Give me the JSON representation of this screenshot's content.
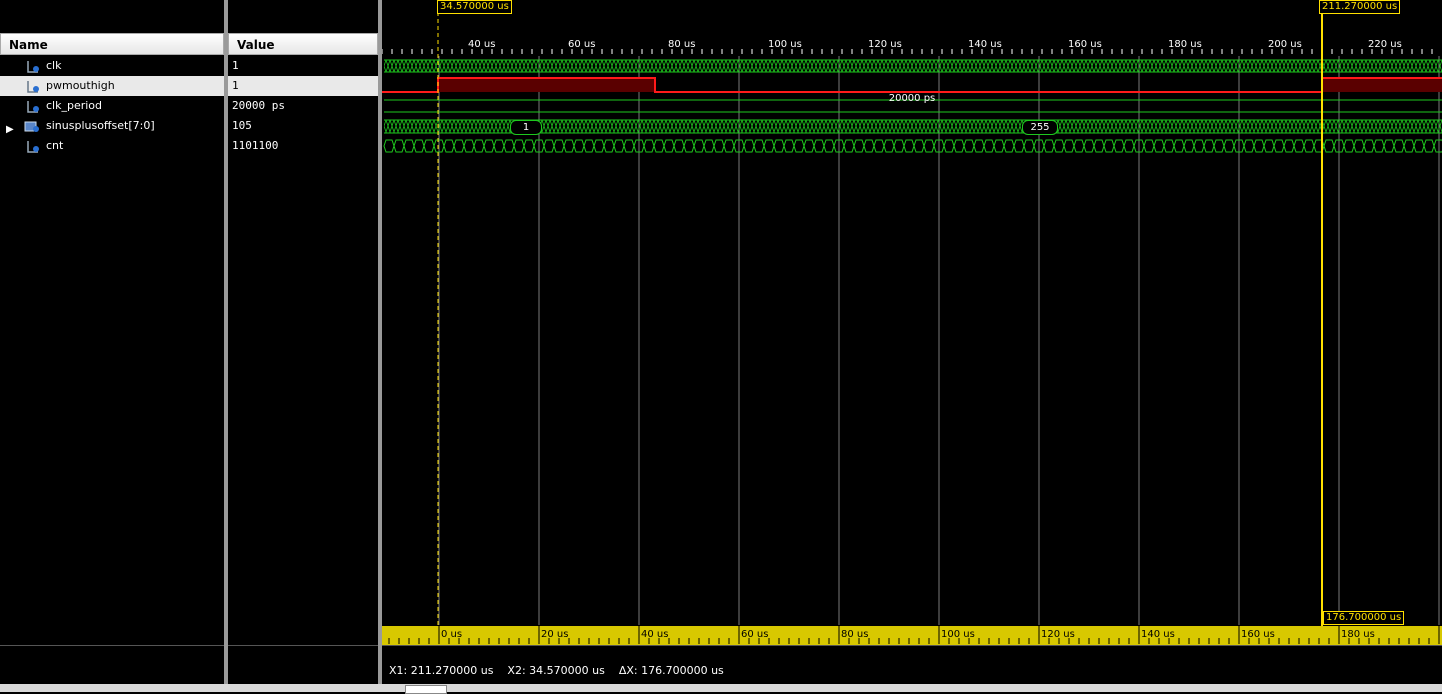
{
  "columns": {
    "name": "Name",
    "value": "Value"
  },
  "signals": [
    {
      "name": "clk",
      "value": "1",
      "icon": "signal-bit-icon"
    },
    {
      "name": "pwmouthigh",
      "value": "1",
      "icon": "signal-bit-icon"
    },
    {
      "name": "clk_period",
      "value": "20000 ps",
      "icon": "signal-bit-icon"
    },
    {
      "name": "sinusplusoffset[7:0]",
      "value": "105",
      "icon": "bus-icon"
    },
    {
      "name": "cnt",
      "value": "1101100",
      "icon": "signal-bit-icon"
    }
  ],
  "timeline_top": {
    "labels": [
      "40 us",
      "60 us",
      "80 us",
      "100 us",
      "120 us",
      "140 us",
      "160 us",
      "180 us",
      "200 us",
      "220 us"
    ],
    "values": [
      40,
      60,
      80,
      100,
      120,
      140,
      160,
      180,
      200,
      220
    ]
  },
  "timeline_bottom": {
    "labels": [
      "0 us",
      "20 us",
      "40 us",
      "60 us",
      "80 us",
      "100 us",
      "120 us",
      "140 us",
      "160 us",
      "180 us"
    ],
    "values": [
      0,
      20,
      40,
      60,
      80,
      100,
      120,
      140,
      160,
      180
    ]
  },
  "cursors": {
    "x2_label": "34.570000 us",
    "x1_label": "211.270000 us",
    "delta_label": "176.700000 us"
  },
  "bus_annotations": {
    "clk_period_value": "20000 ps",
    "sinus_value_a": "1",
    "sinus_value_b": "255"
  },
  "status": {
    "x1": "X1: 211.270000 us",
    "x2": "X2: 34.570000 us",
    "dx": "ΔX: 176.700000 us"
  },
  "colors": {
    "wave_green": "#1ec81e",
    "pwm_red": "#ff1a1a",
    "pwm_fill": "#5a0000",
    "cursor_yellow": "#ffe000",
    "ruler_yellow": "#d8c800"
  }
}
